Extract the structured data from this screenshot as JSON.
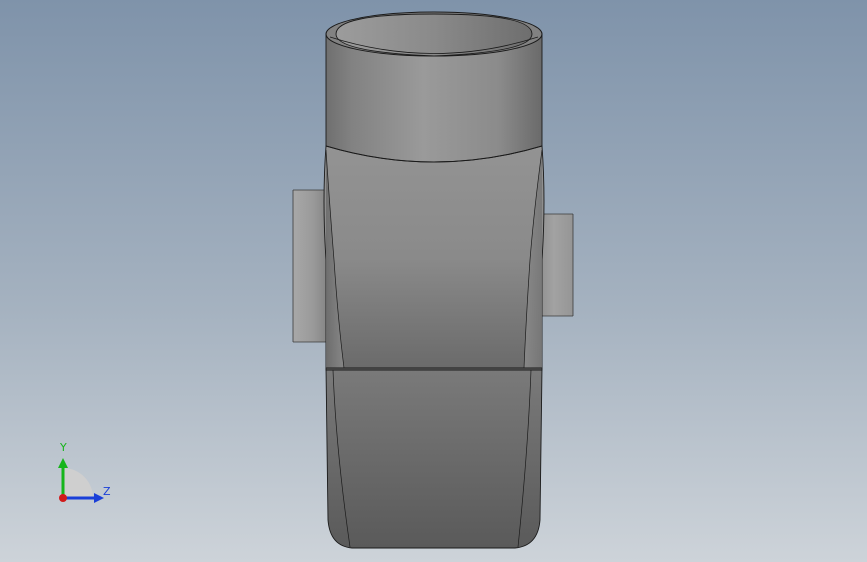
{
  "viewport": {
    "background_top": "#7f93aa",
    "background_bottom": "#cdd3d9",
    "model_color": "#8a8a8a",
    "edge_color": "#1a1a1a"
  },
  "triad": {
    "y_label": "Y",
    "z_label": "Z",
    "y_color": "#16b51a",
    "z_color": "#1a3fd8",
    "x_color": "#d01a1a",
    "label_y_color": "#16b51a",
    "label_z_color": "#1a3fd8"
  }
}
